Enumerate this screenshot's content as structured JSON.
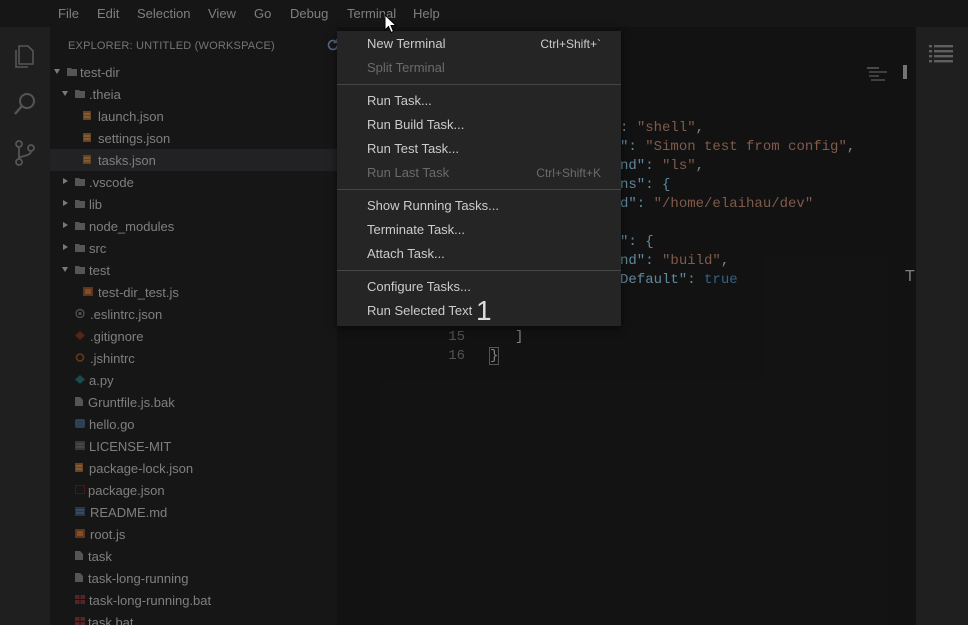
{
  "menubar": {
    "items": [
      "File",
      "Edit",
      "Selection",
      "View",
      "Go",
      "Debug",
      "Terminal",
      "Help"
    ]
  },
  "activity": {
    "icons": [
      "files-icon",
      "search-icon",
      "source-control-icon"
    ]
  },
  "explorer": {
    "title": "EXPLORER: UNTITLED (WORKSPACE)",
    "rows": [
      {
        "label": "test-dir",
        "twisty": "open",
        "icon": "folder-icon"
      },
      {
        "label": ".theia",
        "twisty": "open",
        "icon": "folder-icon"
      },
      {
        "label": "launch.json",
        "icon": "json-file-icon"
      },
      {
        "label": "settings.json",
        "icon": "json-file-icon"
      },
      {
        "label": "tasks.json",
        "icon": "json-file-icon",
        "selected": true
      },
      {
        "label": ".vscode",
        "twisty": "closed",
        "icon": "folder-icon"
      },
      {
        "label": "lib",
        "twisty": "closed",
        "icon": "folder-icon"
      },
      {
        "label": "node_modules",
        "twisty": "closed",
        "icon": "folder-icon"
      },
      {
        "label": "src",
        "twisty": "closed",
        "icon": "folder-icon"
      },
      {
        "label": "test",
        "twisty": "open",
        "icon": "folder-icon"
      },
      {
        "label": "test-dir_test.js",
        "icon": "js-file-icon"
      },
      {
        "label": ".eslintrc.json",
        "icon": "eslint-file-icon"
      },
      {
        "label": ".gitignore",
        "icon": "git-file-icon"
      },
      {
        "label": ".jshintrc",
        "icon": "config-file-icon"
      },
      {
        "label": "a.py",
        "icon": "python-file-icon"
      },
      {
        "label": "Gruntfile.js.bak",
        "icon": "file-icon"
      },
      {
        "label": "hello.go",
        "icon": "go-file-icon"
      },
      {
        "label": "LICENSE-MIT",
        "icon": "license-file-icon"
      },
      {
        "label": "package-lock.json",
        "icon": "json-file-icon"
      },
      {
        "label": "package.json",
        "icon": "npm-file-icon"
      },
      {
        "label": "README.md",
        "icon": "markdown-file-icon"
      },
      {
        "label": "root.js",
        "icon": "js-file-icon"
      },
      {
        "label": "task",
        "icon": "file-icon"
      },
      {
        "label": "task-long-running",
        "icon": "file-icon"
      },
      {
        "label": "task-long-running.bat",
        "icon": "windows-file-icon"
      },
      {
        "label": "task.bat",
        "icon": "windows-file-icon"
      }
    ]
  },
  "editor": {
    "fragments": [
      {
        "k": ": ",
        "s": "\"shell\"",
        "tail": ","
      },
      {
        "k": "\": ",
        "s": "\"Simon test from config\"",
        "tail": ","
      },
      {
        "k": "nd\": ",
        "s": "\"ls\"",
        "tail": ","
      },
      {
        "k": "ns\": {",
        "s": "",
        "tail": ""
      },
      {
        "k": "d\": ",
        "s": "\"/home/elaihau/dev\"",
        "tail": ""
      },
      {
        "k": "",
        "s": "",
        "tail": ""
      },
      {
        "k": "\": {",
        "s": "",
        "tail": ""
      },
      {
        "k": "nd\": ",
        "s": "\"build\"",
        "tail": ","
      },
      {
        "k": "Default\": ",
        "s": "",
        "tail": "",
        "b": "true"
      }
    ],
    "lines": [
      {
        "num": "15",
        "text": "]"
      },
      {
        "num": "16",
        "text": "}"
      }
    ]
  },
  "terminal_menu": {
    "new_terminal": {
      "label": "New Terminal",
      "shortcut": "Ctrl+Shift+`"
    },
    "split_terminal": {
      "label": "Split Terminal"
    },
    "run_task": {
      "label": "Run Task..."
    },
    "run_build_task": {
      "label": "Run Build Task..."
    },
    "run_test_task": {
      "label": "Run Test Task..."
    },
    "run_last_task": {
      "label": "Run Last Task",
      "shortcut": "Ctrl+Shift+K"
    },
    "show_running_tasks": {
      "label": "Show Running Tasks..."
    },
    "terminate_task": {
      "label": "Terminate Task..."
    },
    "attach_task": {
      "label": "Attach Task..."
    },
    "configure_tasks": {
      "label": "Configure Tasks..."
    },
    "run_selected_text": {
      "label": "Run Selected Text"
    }
  },
  "overlay_number": "1",
  "right_letter": "T"
}
